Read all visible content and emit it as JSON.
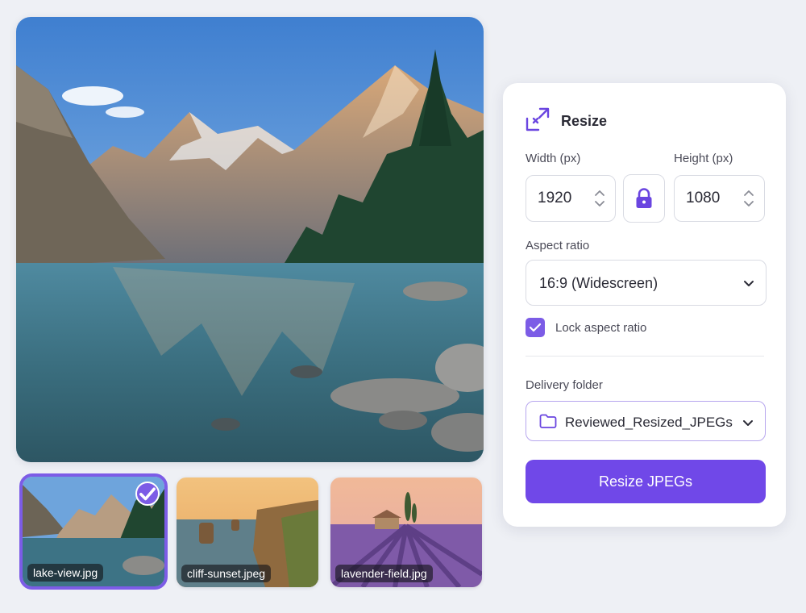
{
  "preview": {
    "image": "lake-view-preview"
  },
  "thumbnails": [
    {
      "label": "lake-view.jpg",
      "selected": true
    },
    {
      "label": "cliff-sunset.jpeg",
      "selected": false
    },
    {
      "label": "lavender-field.jpg",
      "selected": false
    }
  ],
  "panel": {
    "title": "Resize",
    "width_label": "Width (px)",
    "height_label": "Height (px)",
    "width_value": "1920",
    "height_value": "1080",
    "aspect_label": "Aspect ratio",
    "aspect_value": "16:9 (Widescreen)",
    "lock_label": "Lock aspect ratio",
    "lock_checked": true,
    "folder_label": "Delivery folder",
    "folder_value": "Reviewed_Resized_JPEGs",
    "submit_label": "Resize JPEGs"
  },
  "colors": {
    "accent": "#7048e8",
    "selected_outline": "#7c5ce6"
  }
}
